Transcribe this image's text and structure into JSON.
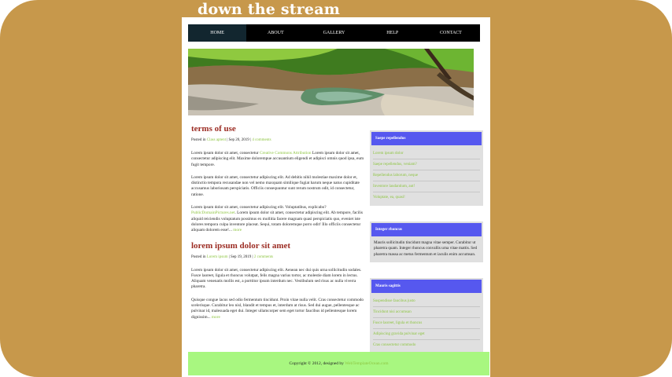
{
  "site": {
    "title": "down the stream"
  },
  "nav": {
    "items": [
      "HOME",
      "ABOUT",
      "GALLERY",
      "HELP",
      "CONTACT"
    ]
  },
  "posts": [
    {
      "title": "terms of use",
      "meta_prefix": "Posted in",
      "category": "Class aptent",
      "date": "| Sep 20, 2019 |",
      "comments": "4 comments",
      "p1_a": "Lorem ipsum dolor sit amet, consectetur",
      "p1_link": "Creative Commons Attribution",
      "p1_b": "Lorem ipsum dolor sit amet, consectetur adipiscing elit. Maxime dolorempue accusantium eligendi et adipisci omnis quod ipsa, eum fugit tempore.",
      "p2": "Lorem ipsum dolor sit amet, consectetur adipiscing elit. Ad debitis nihil molestiae maxime dolor et, distinctio tempora recusandae non vel nemo maxquam similique fugiat harum neque natus cupiditate accusamus laboriosam perspiciatis. Officiis consequuntur sunt rerum nostrum odit, id consectetur, ratione.",
      "p3_a": "Lorem ipsum dolor sit amet, consectetur adipiscing elit. Voluptatibus, explicabo?",
      "p3_link": "PublicDomainPictures.net",
      "p3_b": ". Lorem ipsum dolor sit amet, consectetur adipiscing elit. Ab tempore, facilis aliquid reiciendis voluptatum possimus ex mollitia facere magnam quasi perspiciatis quo, eveniet iste dolores tempora culpa inventore placeat. Sequi, totam doloremque porro odit! Illo officiis consectetur aliquam dolorem esse!...",
      "more": "more"
    },
    {
      "title": "lorem ipsum dolor sit amet",
      "meta_prefix": "Posted in",
      "category": "Lorem ipsum",
      "date": "| Sep 19, 2019 |",
      "comments": "2 comments",
      "p1": "Lorem ipsum dolor sit amet, consectetur adipiscing elit. Aenean nec dui quis urna sollicitudin sodales. Fusce laoreet, ligula et rhoncus volutpat, felis magna varius tortor, ac molestie diam lorem in lectus. Aliquam venenatis mollis est, a porttitor ipsum interdum nec. Vestibulum sed risus ac nulla viverra pharetra.",
      "p2": "Quisque congue lacus sed odio fermentum tincidunt. Proin vitae nulla velit. Cras consectetur commodo scelerisque. Curabitur leo nisl, blandit et tempus et, interdum at risus. Sed dui augue, pellentesque ac pulvinar id, malesuada eget dui. Integer ullamcorper sem eget tortor faucibus id pellentesque lorem dignissim...",
      "more": "more"
    }
  ],
  "sidebar": {
    "widget1": {
      "title": "Saepe repellendus",
      "items": [
        "Lorem ipsum dolor",
        "Saepe repellendus, veniam?",
        "Repellendus laborum, neque",
        "Inventore laudantium, aut!",
        "Voluptate, ea, quasi!"
      ]
    },
    "widget2": {
      "title": "Integer rhoncus",
      "text": "Mauris sollicitudin tincidunt magna vitae semper. Curabitur ut pharetra quam. Integer rhoncus convallis urna vitae mattis. Sed pharetra massa ac metus fermentum et iaculis enim accumsan."
    },
    "widget3": {
      "title": "Mauris sagittis",
      "items": [
        "Suspendisse faucibus justo",
        "Tincidunt nisi accumsan",
        "Fusce laoreet, ligula et rhoncus",
        "Adipiscing gravida pulvinar eget",
        "Cras consectetur commodo"
      ]
    }
  },
  "footer": {
    "text": "Copyright © 2012, designed by",
    "link": "WebTemplateOcean.com"
  },
  "colors": {
    "background": "#c7984b",
    "post_title": "#9c2d24",
    "link": "#8cc43f",
    "widget_head": "#5658ef",
    "footer": "#a8f780"
  }
}
